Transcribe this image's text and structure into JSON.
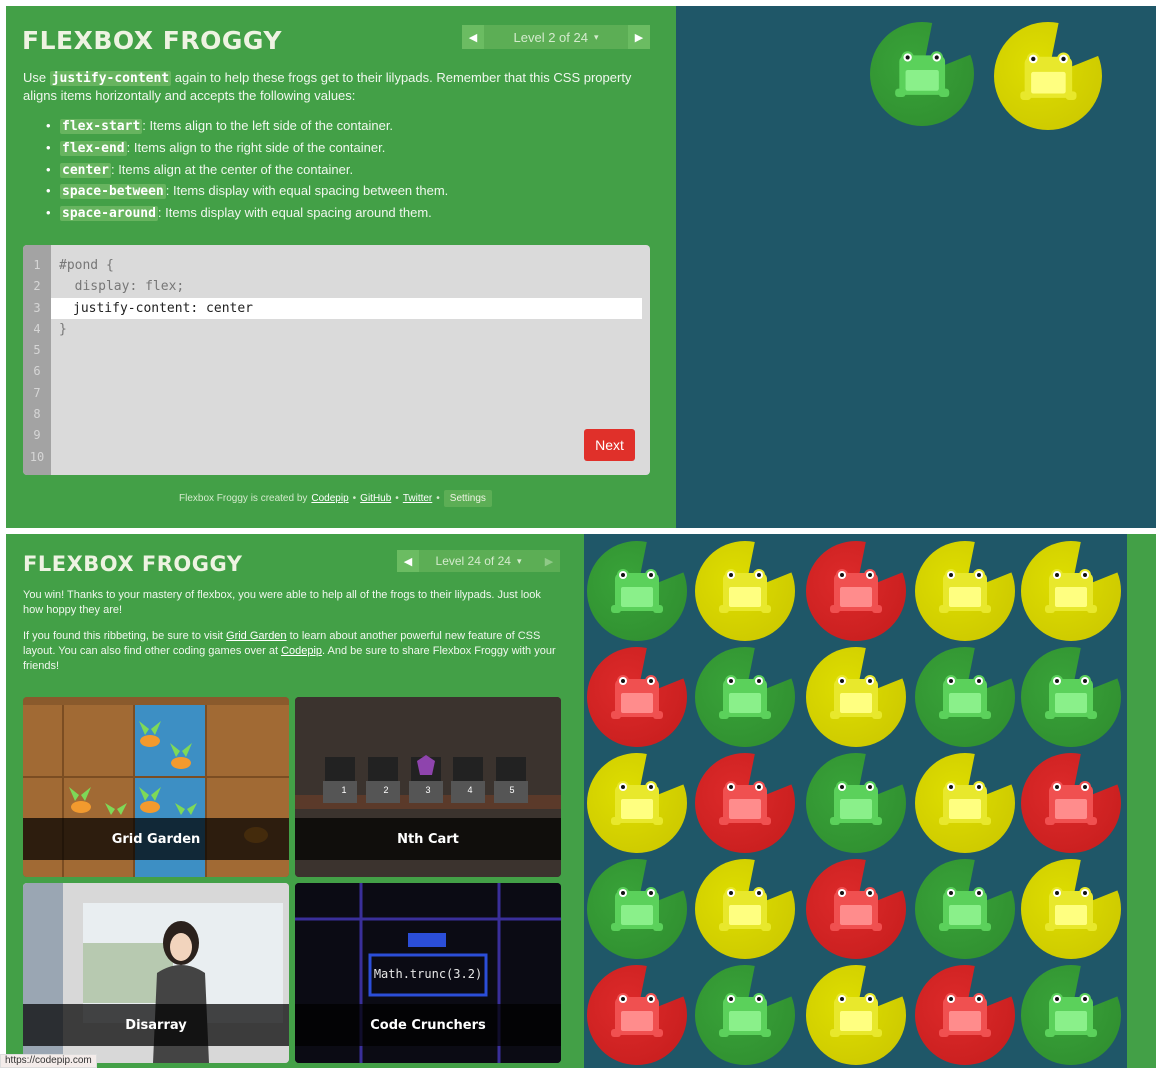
{
  "top": {
    "logo": "FLEXBOX FROGGY",
    "level": {
      "label": "Level 2 of 24",
      "caret": "▾"
    },
    "intro_pre": "Use ",
    "intro_code": "justify-content",
    "intro_post": " again to help these frogs get to their lilypads. Remember that this CSS property aligns items horizontally and accepts the following values:",
    "props": [
      {
        "code": "flex-start",
        "text": ": Items align to the left side of the container."
      },
      {
        "code": "flex-end",
        "text": ": Items align to the right side of the container."
      },
      {
        "code": "center",
        "text": ": Items align at the center of the container."
      },
      {
        "code": "space-between",
        "text": ": Items display with equal spacing between them."
      },
      {
        "code": "space-around",
        "text": ": Items display with equal spacing around them."
      }
    ],
    "line_numbers": [
      "1",
      "2",
      "3",
      "4",
      "5",
      "6",
      "7",
      "8",
      "9",
      "10"
    ],
    "code_line1": "#pond {",
    "code_line2": "  display: flex;",
    "code_input": "justify-content: center",
    "code_line4": "}",
    "next_label": "Next",
    "footer": {
      "pre": "Flexbox Froggy is created by",
      "codepip": "Codepip",
      "github": "GitHub",
      "twitter": "Twitter",
      "settings": "Settings",
      "sep": "•"
    }
  },
  "bottom": {
    "logo": "FLEXBOX FROGGY",
    "level": {
      "label": "Level 24 of 24",
      "caret": "▾"
    },
    "win_text": "You win! Thanks to your mastery of flexbox, you were able to help all of the frogs to their lilypads. Just look how hoppy they are!",
    "p2_a": "If you found this ribbeting, be sure to visit ",
    "p2_link1": "Grid Garden",
    "p2_b": " to learn about another powerful new feature of CSS layout. You can also find other coding games over at ",
    "p2_link2": "Codepip",
    "p2_c": ". And be sure to share Flexbox Froggy with your friends!",
    "games": [
      {
        "name": "Grid Garden"
      },
      {
        "name": "Nth Cart"
      },
      {
        "name": "Disarray"
      },
      {
        "name": "Code Crunchers",
        "code": "Math.trunc(3.2)"
      }
    ],
    "cart_numbers": [
      "1",
      "2",
      "3",
      "4",
      "5"
    ]
  },
  "status_url": "https://codepip.com",
  "colors": {
    "green": "#43a047",
    "pond": "#1f5768",
    "red": "#e0302a",
    "yellow": "#d4d400"
  },
  "icons": {
    "prev": "◀",
    "next": "▶"
  }
}
